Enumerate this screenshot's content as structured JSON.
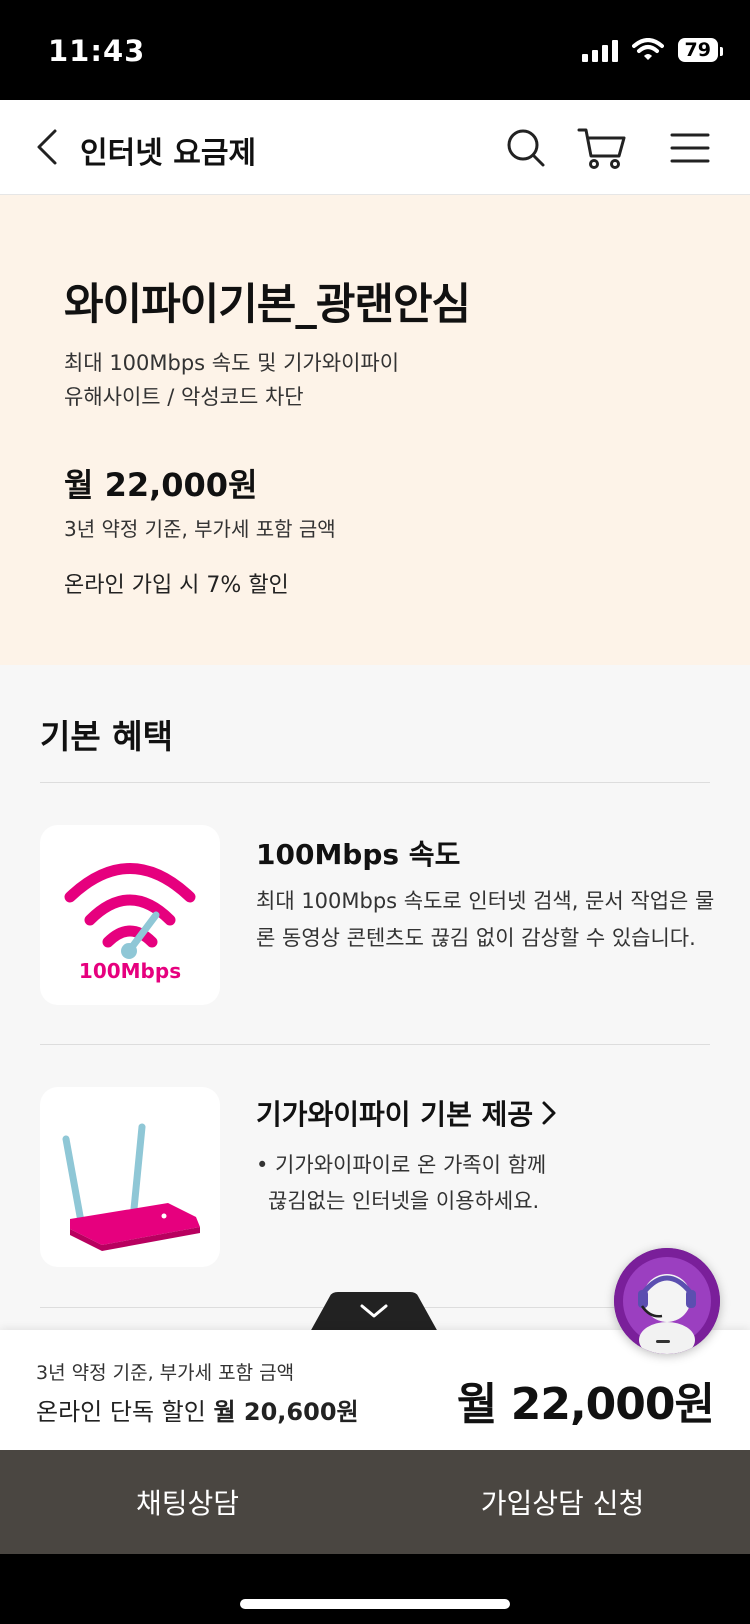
{
  "status": {
    "time": "11:43",
    "battery": "79"
  },
  "header": {
    "title": "인터넷 요금제"
  },
  "plan": {
    "title": "와이파이기본_광랜안심",
    "desc_1": "최대 100Mbps 속도 및 기가와이파이",
    "desc_2": "유해사이트 / 악성코드 차단",
    "price": "월 22,000원",
    "price_note": "3년 약정 기준, 부가세 포함 금액",
    "discount_note": "온라인 가입 시 7% 할인"
  },
  "benefits": {
    "section_title": "기본 혜택",
    "items": [
      {
        "title": "100Mbps 속도",
        "image_label": "100Mbps",
        "desc": "최대 100Mbps 속도로 인터넷 검색, 문서 작업은 물론 동영상 콘텐츠도 끊김 없이 감상할 수 있습니다."
      },
      {
        "title": "기가와이파이 기본 제공",
        "bullet_1": "• 기가와이파이로 온 가족이 함께",
        "bullet_2": "끊김없는 인터넷을 이용하세요."
      }
    ]
  },
  "bottom_bar": {
    "note": "3년 약정 기준, 부가세 포함 금액",
    "online_label": "온라인 단독 할인",
    "online_price": "월 20,600원",
    "price": "월 22,000원"
  },
  "actions": {
    "chat": "채팅상담",
    "apply": "가입상담 신청"
  },
  "colors": {
    "accent": "#e6007e",
    "hero_bg": "#fdf3e8",
    "action_bar": "#4a4641"
  }
}
